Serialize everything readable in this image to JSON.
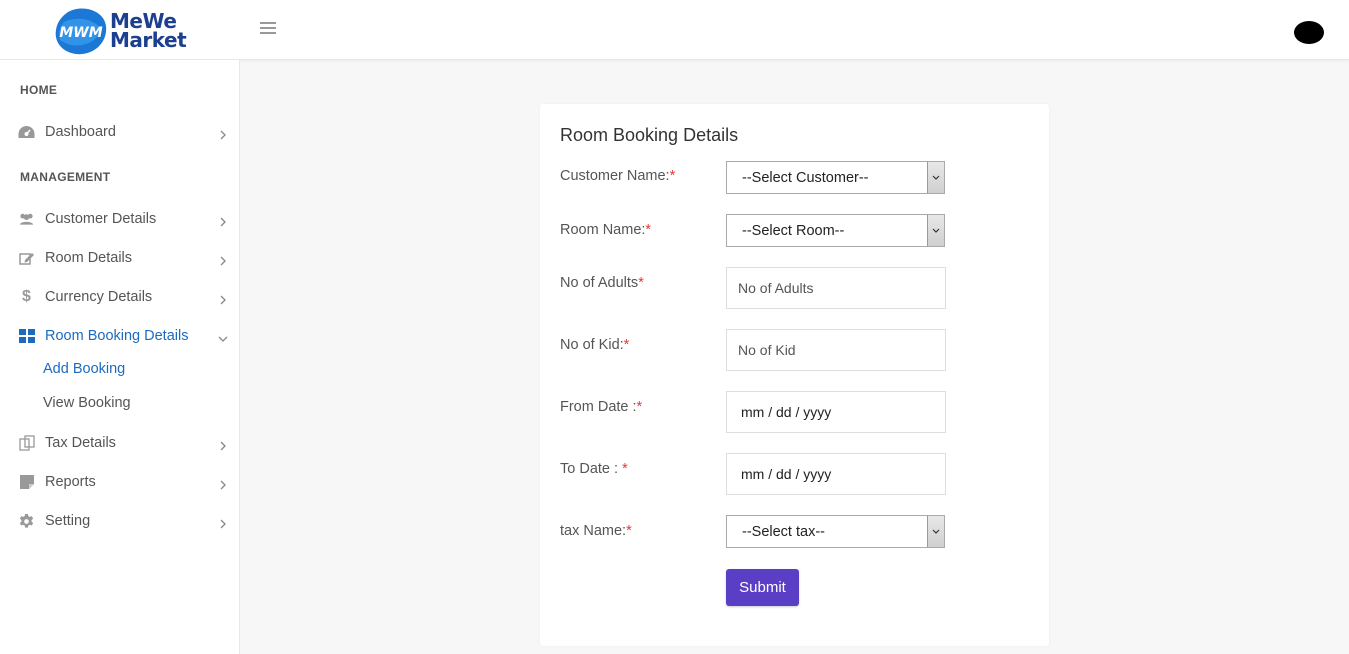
{
  "brand": {
    "name_line1": "MeWe",
    "name_line2": "Market",
    "badge_text": "MWM"
  },
  "sidebar": {
    "sections": [
      "HOME",
      "MANAGEMENT"
    ],
    "items": [
      {
        "label": "Dashboard",
        "icon": "dashboard-icon"
      },
      {
        "label": "Customer Details",
        "icon": "users-icon"
      },
      {
        "label": "Room Details",
        "icon": "edit-icon"
      },
      {
        "label": "Currency Details",
        "icon": "dollar-icon"
      },
      {
        "label": "Room Booking Details",
        "icon": "grid-icon",
        "expanded": true
      },
      {
        "label": "Tax Details",
        "icon": "tax-icon"
      },
      {
        "label": "Reports",
        "icon": "report-icon"
      },
      {
        "label": "Setting",
        "icon": "gear-icon"
      }
    ],
    "sub_items": [
      "Add Booking",
      "View Booking"
    ]
  },
  "form": {
    "title": "Room Booking Details",
    "customer_label": "Customer Name:",
    "customer_value": "--Select Customer--",
    "room_label": "Room Name:",
    "room_value": "--Select Room--",
    "adults_label": "No of Adults",
    "adults_placeholder": "No of Adults",
    "kid_label": "No of Kid:",
    "kid_placeholder": "No of Kid",
    "from_label": "From Date :",
    "from_value": "mm / dd / yyyy",
    "to_label": "To Date : ",
    "to_value": "mm / dd / yyyy",
    "tax_label": "tax Name:",
    "tax_value": "--Select tax--",
    "required_mark": "*",
    "submit_label": "Submit"
  },
  "colors": {
    "accent": "#1d6bbf",
    "submit": "#5a3fc6",
    "required": "#e53935",
    "brand": "#1c3f8f"
  }
}
